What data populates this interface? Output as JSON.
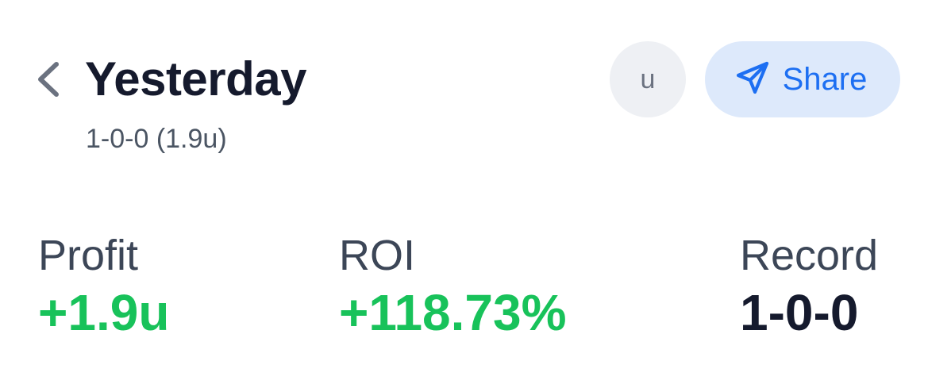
{
  "header": {
    "title": "Yesterday",
    "subtitle": "1-0-0 (1.9u)",
    "unit_button_label": "u",
    "share_label": "Share"
  },
  "icons": {
    "back": "chevron-left-icon",
    "share": "paper-plane-icon"
  },
  "stats": [
    {
      "label": "Profit",
      "value": "+1.9u"
    },
    {
      "label": "ROI",
      "value": "+118.73%"
    },
    {
      "label": "Record",
      "value": "1-0-0"
    }
  ],
  "colors": {
    "title": "#151a2d",
    "positive": "#18c25a",
    "share_accent": "#1d6ff2",
    "share_background": "#dde9fb",
    "unit_button_background": "#eef0f4"
  }
}
